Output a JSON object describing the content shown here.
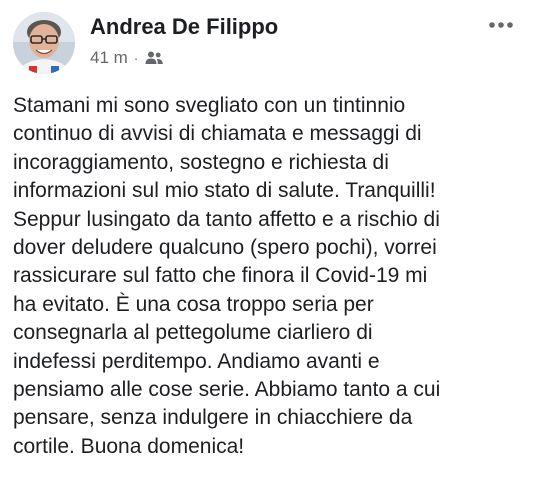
{
  "post": {
    "author_name": "Andrea De Filippo",
    "timestamp": "41 m",
    "separator": "·",
    "audience_icon": "friends-icon",
    "more_icon": "more-horizontal-icon",
    "text_lines": [
      "Stamani mi sono svegliato con un tintinnio",
      "continuo di avvisi di chiamata e messaggi di",
      "incoraggiamento, sostegno e richiesta di",
      "informazioni sul mio stato di salute. Tranquilli!",
      "Seppur lusingato da tanto affetto e a rischio di",
      "dover deludere qualcuno (spero pochi), vorrei",
      "rassicurare sul fatto che finora il Covid-19 mi",
      "ha evitato. È una cosa troppo seria per",
      "consegnarla al pettegolume ciarliero di",
      "indefessi perditempo. Andiamo avanti e",
      "pensiamo alle cose serie. Abbiamo tanto a cui",
      "pensare, senza indulgere in chiacchiere da",
      "cortile. Buona domenica!"
    ]
  },
  "colors": {
    "text_primary": "#1c1e21",
    "text_secondary": "#65676b",
    "background": "#ffffff"
  }
}
